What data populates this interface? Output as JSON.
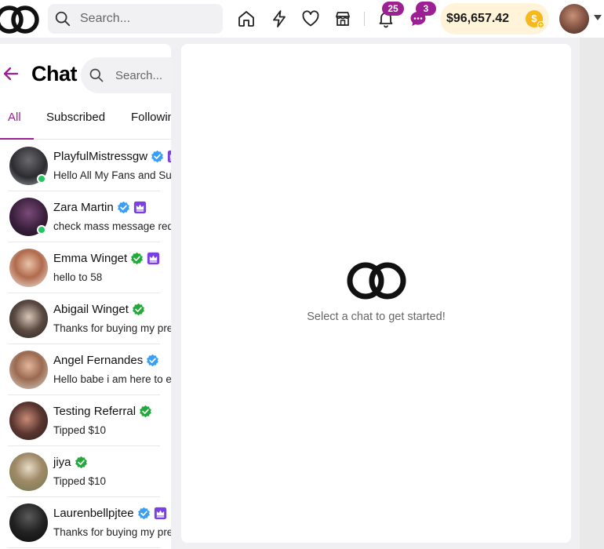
{
  "header": {
    "search_placeholder": "Search...",
    "notifications_count": "25",
    "messages_count": "3",
    "balance": "$96,657.42",
    "coin_symbol": "$"
  },
  "chat": {
    "title": "Chat",
    "search_placeholder": "Search...",
    "tabs": [
      {
        "label": "All",
        "active": true
      },
      {
        "label": "Subscribed",
        "active": false
      },
      {
        "label": "Following",
        "active": false
      }
    ],
    "conversations": [
      {
        "name": "PlayfulMistressgw",
        "message": "Hello All My Fans and Subscribers",
        "verified": "blue",
        "crown": true,
        "online": true
      },
      {
        "name": "Zara Martin",
        "message": "check mass message redeem",
        "verified": "blue",
        "crown": true,
        "online": true
      },
      {
        "name": "Emma Winget",
        "message": "hello to 58",
        "verified": "green",
        "crown": true,
        "online": false
      },
      {
        "name": "Abigail Winget",
        "message": "Thanks for buying my premium",
        "verified": "green",
        "crown": false,
        "online": false
      },
      {
        "name": "Angel Fernandes",
        "message": "Hello babe i am here to entertain",
        "verified": "blue",
        "crown": false,
        "online": false
      },
      {
        "name": "Testing Referral",
        "message": "Tipped $10",
        "verified": "green",
        "crown": false,
        "online": false
      },
      {
        "name": "jiya",
        "message": "Tipped $10",
        "verified": "green",
        "crown": false,
        "online": false
      },
      {
        "name": "Laurenbellpjtee",
        "message": "Thanks for buying my premium",
        "verified": "blue",
        "crown": true,
        "online": false
      }
    ]
  },
  "main": {
    "empty_text": "Select a chat to get started!"
  },
  "colors": {
    "brand": "#9c1f93",
    "verified_blue": "#3b9ef5",
    "verified_green": "#22a93a",
    "online": "#22c55e",
    "balance_bg": "#fff4da",
    "coin": "#f6b81f"
  },
  "icons": {
    "nav": [
      "home-icon",
      "lightning-icon",
      "heart-icon",
      "store-icon",
      "bell-icon",
      "chat-bubble-icon"
    ]
  }
}
